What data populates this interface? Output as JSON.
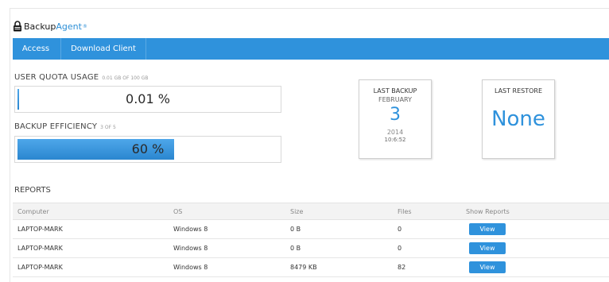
{
  "logo": {
    "text1": "Backup",
    "text2": "Agent",
    "reg": "®"
  },
  "nav": {
    "tabs": [
      {
        "label": "Access"
      },
      {
        "label": "Download Client"
      }
    ]
  },
  "quota": {
    "label": "USER QUOTA USAGE",
    "sub": "0.01 GB OF 100 GB",
    "value": "0.01 %",
    "fraction": 0.0001
  },
  "efficiency": {
    "label": "BACKUP EFFICIENCY",
    "sub": "3 OF 5",
    "value": "60 %",
    "fraction": 0.6
  },
  "last_backup": {
    "title": "LAST BACKUP",
    "month": "FEBRUARY",
    "day": "3",
    "year": "2014",
    "time": "10:6:52"
  },
  "last_restore": {
    "title": "LAST RESTORE",
    "value": "None"
  },
  "reports": {
    "title": "REPORTS",
    "columns": [
      "Computer",
      "OS",
      "Size",
      "Files",
      "Show Reports"
    ],
    "rows": [
      {
        "computer": "LAPTOP-MARK",
        "os": "Windows 8",
        "size": "0 B",
        "files": "0",
        "action": "View"
      },
      {
        "computer": "LAPTOP-MARK",
        "os": "Windows 8",
        "size": "0 B",
        "files": "0",
        "action": "View"
      },
      {
        "computer": "LAPTOP-MARK",
        "os": "Windows 8",
        "size": "8479 KB",
        "files": "82",
        "action": "View"
      }
    ]
  },
  "colors": {
    "accent": "#2f92dc"
  }
}
